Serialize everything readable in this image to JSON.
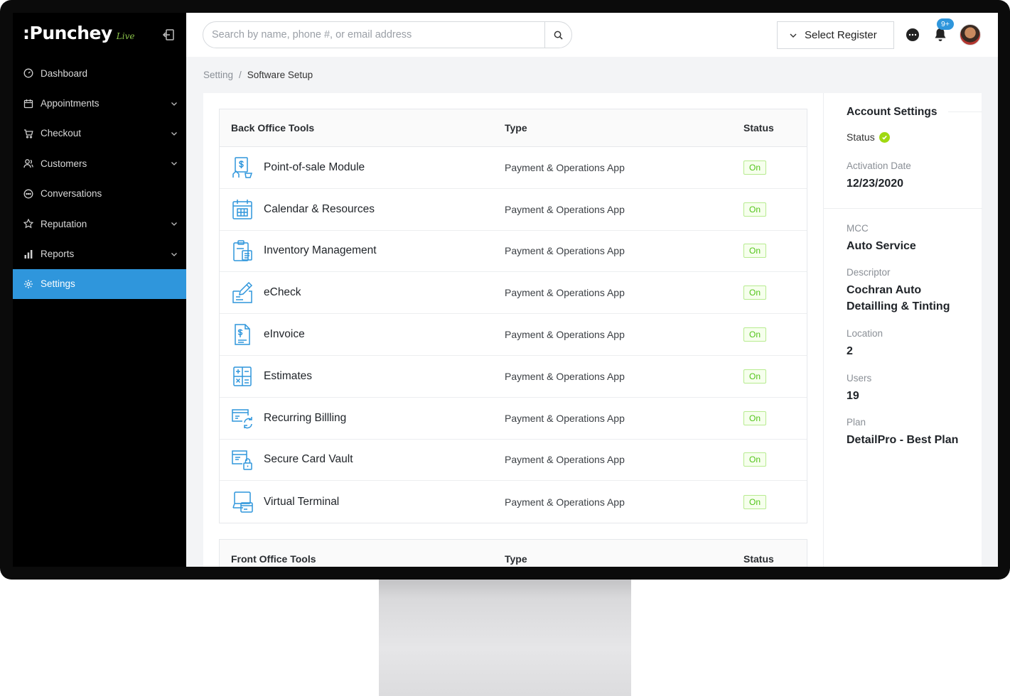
{
  "brand": {
    "name": ":Punchey",
    "badge": "Live"
  },
  "sidebar": {
    "items": [
      {
        "label": "Dashboard",
        "icon": "dashboard-icon",
        "expandable": false,
        "active": false
      },
      {
        "label": "Appointments",
        "icon": "calendar-icon",
        "expandable": true,
        "active": false
      },
      {
        "label": "Checkout",
        "icon": "cart-icon",
        "expandable": true,
        "active": false
      },
      {
        "label": "Customers",
        "icon": "users-icon",
        "expandable": true,
        "active": false
      },
      {
        "label": "Conversations",
        "icon": "chat-icon",
        "expandable": false,
        "active": false
      },
      {
        "label": "Reputation",
        "icon": "star-icon",
        "expandable": true,
        "active": false
      },
      {
        "label": "Reports",
        "icon": "bar-chart-icon",
        "expandable": true,
        "active": false
      },
      {
        "label": "Settings",
        "icon": "gear-icon",
        "expandable": false,
        "active": true
      }
    ]
  },
  "header": {
    "search_placeholder": "Search by name, phone #, or email address",
    "register_label": "Select Register",
    "notification_count": "9+"
  },
  "breadcrumb": {
    "parent": "Setting",
    "separator": "/",
    "current": "Software Setup"
  },
  "back_office": {
    "headers": {
      "name": "Back Office Tools",
      "type": "Type",
      "status": "Status"
    },
    "rows": [
      {
        "name": "Point-of-sale Module",
        "type": "Payment & Operations App",
        "status": "On",
        "icon": "pos-icon"
      },
      {
        "name": "Calendar & Resources",
        "type": "Payment & Operations App",
        "status": "On",
        "icon": "calendar-grid-icon"
      },
      {
        "name": "Inventory Management",
        "type": "Payment & Operations App",
        "status": "On",
        "icon": "clipboard-icon"
      },
      {
        "name": "eCheck",
        "type": "Payment & Operations App",
        "status": "On",
        "icon": "pen-check-icon"
      },
      {
        "name": "eInvoice",
        "type": "Payment & Operations App",
        "status": "On",
        "icon": "invoice-icon"
      },
      {
        "name": "Estimates",
        "type": "Payment & Operations App",
        "status": "On",
        "icon": "calculator-icon"
      },
      {
        "name": "Recurring Billling",
        "type": "Payment & Operations App",
        "status": "On",
        "icon": "recurring-card-icon"
      },
      {
        "name": "Secure Card Vault",
        "type": "Payment & Operations App",
        "status": "On",
        "icon": "card-lock-icon"
      },
      {
        "name": "Virtual Terminal",
        "type": "Payment & Operations App",
        "status": "On",
        "icon": "terminal-icon"
      }
    ]
  },
  "front_office": {
    "headers": {
      "name": "Front Office Tools",
      "type": "Type",
      "status": "Status"
    }
  },
  "account": {
    "title": "Account Settings",
    "status_label": "Status",
    "activation_label": "Activation Date",
    "activation_date": "12/23/2020",
    "mcc_label": "MCC",
    "mcc": "Auto Service",
    "descriptor_label": "Descriptor",
    "descriptor": "Cochran Auto Detailling & Tinting",
    "location_label": "Location",
    "location": "2",
    "users_label": "Users",
    "users": "19",
    "plan_label": "Plan",
    "plan": "DetailPro - Best Plan"
  },
  "colors": {
    "sidebar_bg": "#000000",
    "accent": "#2f96dc",
    "status_green": "#52c41a",
    "check_green": "#a0d911"
  }
}
